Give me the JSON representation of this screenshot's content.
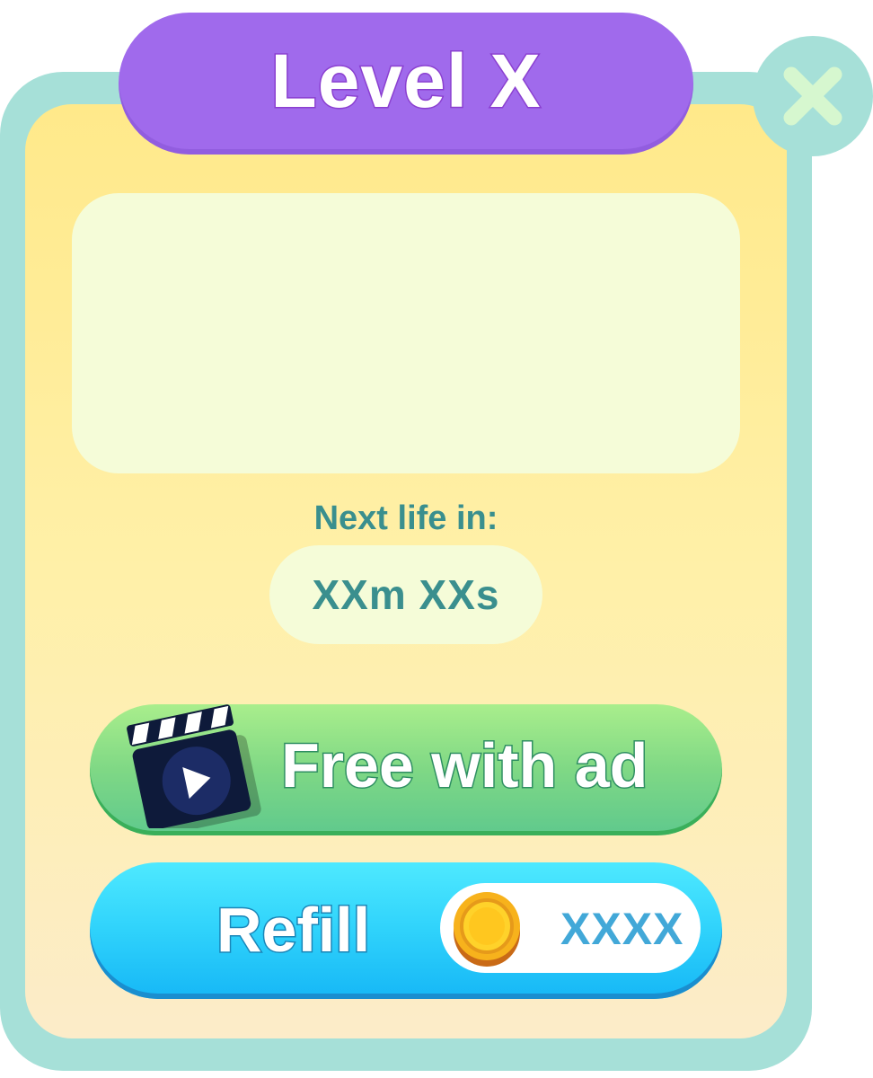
{
  "popup": {
    "title": "Level X",
    "next_life_label": "Next life in:",
    "timer": "XXm XXs"
  },
  "buttons": {
    "close_icon": "close-x-icon",
    "free_with_ad_label": "Free with ad",
    "free_with_ad_icon": "clapperboard-play-icon",
    "refill_label": "Refill",
    "refill_price": "XXXX",
    "refill_currency_icon": "gold-coin-icon"
  },
  "colors": {
    "frame": "#a6e0d8",
    "panel": "#ffe98a",
    "title_bar": "#a06aec",
    "close_x": "#d6f7cf",
    "ad_button": "#7fd885",
    "refill_button": "#2fd2fb",
    "accent_text": "#3a8f8e",
    "price_text": "#42a8d8"
  }
}
